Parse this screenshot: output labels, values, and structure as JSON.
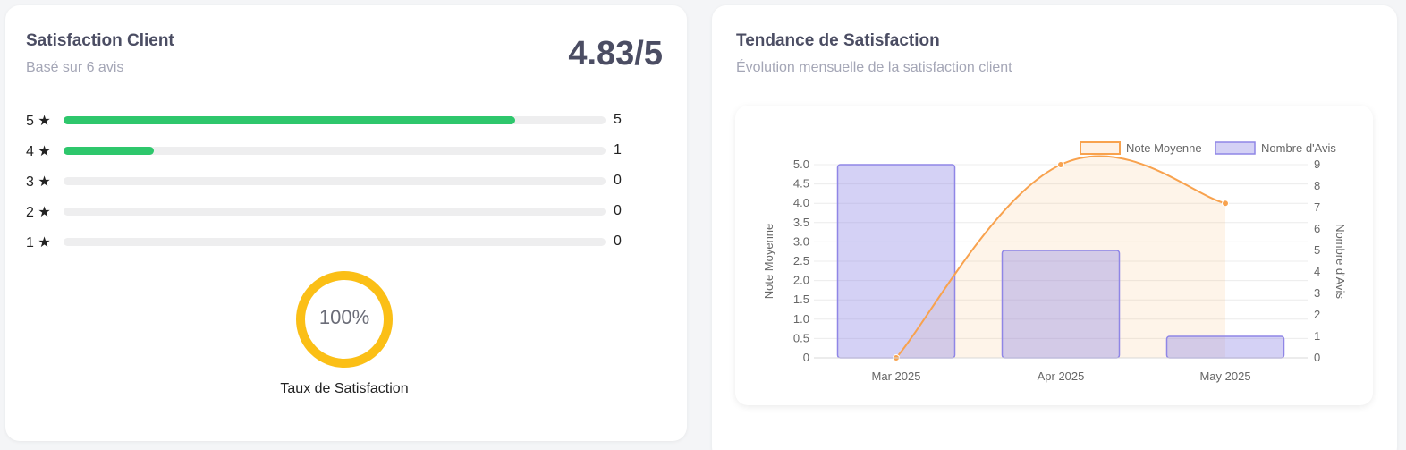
{
  "satisfaction": {
    "title": "Satisfaction Client",
    "subtitle": "Basé sur 6 avis",
    "score": "4.83/5",
    "distribution": [
      {
        "label": "5 ★",
        "count": "5",
        "fraction": 0.8333
      },
      {
        "label": "4 ★",
        "count": "1",
        "fraction": 0.1667
      },
      {
        "label": "3 ★",
        "count": "0",
        "fraction": 0
      },
      {
        "label": "2 ★",
        "count": "0",
        "fraction": 0
      },
      {
        "label": "1 ★",
        "count": "0",
        "fraction": 0
      }
    ],
    "gauge": {
      "value": "100%",
      "fraction": 1.0,
      "label": "Taux de Satisfaction",
      "color": "#fbbf16"
    },
    "bar_color": "#2ec76c"
  },
  "trend": {
    "title": "Tendance de Satisfaction",
    "subtitle": "Évolution mensuelle de la satisfaction client"
  },
  "chart_data": {
    "type": "bar",
    "categories": [
      "Mar 2025",
      "Apr 2025",
      "May 2025"
    ],
    "series": [
      {
        "name": "Note Moyenne",
        "type": "area",
        "axis": "left",
        "values": [
          0,
          5.0,
          4.0
        ],
        "color": "#f8a24e"
      },
      {
        "name": "Nombre d'Avis",
        "type": "bar",
        "axis": "right",
        "values": [
          9,
          5,
          1
        ],
        "color": "#8f86e6"
      }
    ],
    "ylabel_left": "Note Moyenne",
    "ylabel_right": "Nombre d'Avis",
    "ylim_left": [
      0,
      5
    ],
    "ylim_right": [
      0,
      9
    ],
    "yticks_left": [
      "0",
      "0.5",
      "1.0",
      "1.5",
      "2.0",
      "2.5",
      "3.0",
      "3.5",
      "4.0",
      "4.5",
      "5.0"
    ],
    "yticks_right": [
      "0",
      "1",
      "2",
      "3",
      "4",
      "5",
      "6",
      "7",
      "8",
      "9"
    ],
    "legend_position": "top-right",
    "grid": true
  }
}
